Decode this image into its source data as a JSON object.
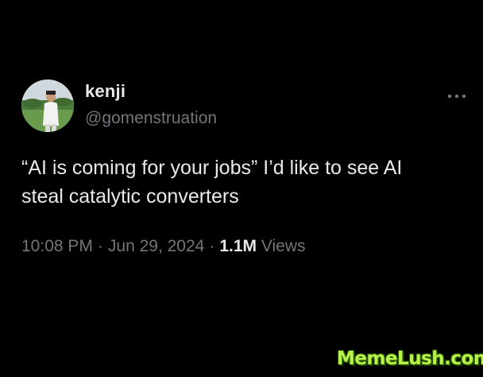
{
  "tweet": {
    "author": {
      "display_name": "kenji",
      "handle": "@gomenstruation",
      "avatar_icon": "profile-photo"
    },
    "more_icon": "more-dots-icon",
    "text_lines": [
      "“AI is coming for your jobs” I’d like to see AI",
      "steal catalytic converters"
    ],
    "meta": {
      "time": "10:08 PM",
      "separator": "·",
      "date": "Jun 29, 2024",
      "views_count": "1.1M",
      "views_label": "Views"
    }
  },
  "watermark": {
    "text": "MemeLush.com",
    "color": "#b9f24a"
  },
  "colors": {
    "background": "#000000",
    "primary_text": "#e7e9ea",
    "secondary_text": "#71767b"
  }
}
